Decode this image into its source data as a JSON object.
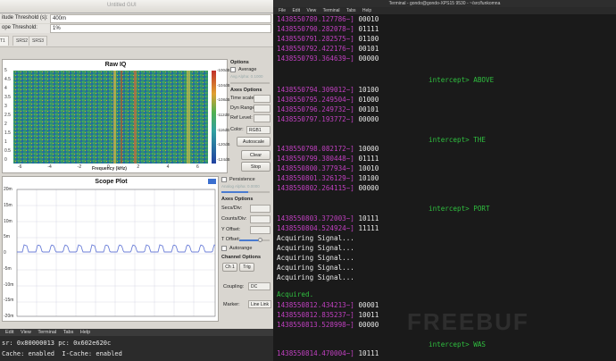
{
  "gui": {
    "window_title": "Untitled GUI",
    "amplitude_label": "itude Threshold (s):",
    "amplitude_value": "400m",
    "slope_label": "ope Threshold:",
    "slope_value": "1%",
    "tabs": [
      "T1",
      "SRS2",
      "SRS3"
    ],
    "raw_iq": {
      "title": "Raw IQ",
      "xlabel": "Frequency (kHz)",
      "x_ticks": [
        "-6",
        "-4",
        "-2",
        "0",
        "2",
        "4",
        "6"
      ],
      "y_ticks": [
        "5",
        "4.5",
        "4",
        "3.5",
        "3",
        "2.5",
        "2",
        "1.5",
        "1",
        "0.5",
        "0"
      ],
      "colorbar_ticks": [
        "-100dB",
        "-104dB",
        "-108dB",
        "-112dB",
        "-116dB",
        "-120dB",
        "-124dB"
      ]
    },
    "raw_options": {
      "options_header": "Options",
      "average_label": "Average",
      "avg_alpha_label": "Avg Alpha: 0.1000",
      "axes_header": "Axes Options",
      "time_scale_label": "Time scale:",
      "dyn_range_label": "Dyn Range:",
      "ref_level_label": "Ref Level:",
      "color_label": "Color:",
      "color_value": "RGB1",
      "autoscale_label": "Autoscale",
      "clear_label": "Clear",
      "stop_label": "Stop"
    },
    "scope": {
      "title": "Scope Plot",
      "y_ticks": [
        "20m",
        "15m",
        "10m",
        "5m",
        "0",
        "-5m",
        "-10m",
        "-15m",
        "-20m"
      ]
    },
    "scope_options": {
      "persistence_label": "Persistence",
      "analog_alpha_label": "Analog Alpha: 0.0000",
      "axes_header": "Axes Options",
      "secs_div_label": "Secs/Div:",
      "counts_div_label": "Counts/Div:",
      "y_offset_label": "Y Offset:",
      "t_offset_label": "T Offset:",
      "autorange_label": "Autorange",
      "channel_header": "Channel Options",
      "ch1_label": "Ch 1",
      "trig_label": "Trig",
      "coupling_label": "Coupling:",
      "coupling_value": "DC",
      "marker_label": "Marker:",
      "marker_value": "Line Link"
    }
  },
  "bottom_terminal": {
    "menu": [
      "Edit",
      "View",
      "Terminal",
      "Tabs",
      "Help"
    ],
    "lines": [
      "sr: 0x80000013 pc: 0x602e620c",
      "Cache: enabled  I-Cache: enabled"
    ]
  },
  "right_terminal": {
    "title": "Terminal - gondo@gondo-XPS15 9530 - ~/src/funkomna",
    "menu": [
      "File",
      "Edit",
      "View",
      "Terminal",
      "Tabs",
      "Help"
    ],
    "lines": [
      {
        "ts": "1438550789.127786~]",
        "bits": "00010"
      },
      {
        "ts": "1438550790.282078~]",
        "bits": "01111"
      },
      {
        "ts": "1438550791.282575~]",
        "bits": "01100"
      },
      {
        "ts": "1438550792.422176~]",
        "bits": "00101"
      },
      {
        "ts": "1438550793.364639~]",
        "bits": "00000"
      },
      {
        "green": "intercept> ABOVE"
      },
      {
        "ts": "1438550794.309012~]",
        "bits": "10100"
      },
      {
        "ts": "1438550795.249504~]",
        "bits": "01000"
      },
      {
        "ts": "1438550796.249732~]",
        "bits": "00101"
      },
      {
        "ts": "1438550797.193772~]",
        "bits": "00000"
      },
      {
        "green": "intercept> THE"
      },
      {
        "ts": "1438550798.082172~]",
        "bits": "10000"
      },
      {
        "ts": "1438550799.380448~]",
        "bits": "01111"
      },
      {
        "ts": "1438550800.377934~]",
        "bits": "10010"
      },
      {
        "ts": "1438550801.326129~]",
        "bits": "10100"
      },
      {
        "ts": "1438550802.264115~]",
        "bits": "00000"
      },
      {
        "green": "intercept> PORT"
      },
      {
        "ts": "1438550803.372003~]",
        "bits": "10111"
      },
      {
        "ts": "1438550804.524924~]",
        "bits": "11111"
      },
      {
        "white": "Acquiring Signal..."
      },
      {
        "white": "Acquiring Signal..."
      },
      {
        "white": "Acquiring Signal..."
      },
      {
        "white": "Acquiring Signal..."
      },
      {
        "white": "Acquiring Signal..."
      },
      {
        "green": "Acquired."
      },
      {
        "ts": "1438550812.434213~]",
        "bits": "00001"
      },
      {
        "ts": "1438550812.835237~]",
        "bits": "10011"
      },
      {
        "ts": "1438550813.528998~]",
        "bits": "00000"
      },
      {
        "green": "intercept> WAS"
      },
      {
        "ts": "1438550814.470004~]",
        "bits": "10111"
      }
    ]
  },
  "watermark": "FREEBUF"
}
